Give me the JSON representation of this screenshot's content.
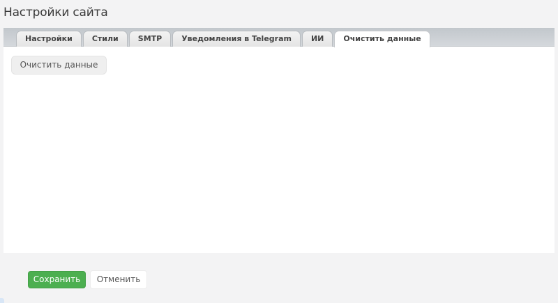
{
  "page": {
    "title": "Настройки сайта"
  },
  "tabs": [
    {
      "label": "Настройки",
      "active": false
    },
    {
      "label": "Стили",
      "active": false
    },
    {
      "label": "SMTP",
      "active": false
    },
    {
      "label": "Уведомления в Telegram",
      "active": false
    },
    {
      "label": "ИИ",
      "active": false
    },
    {
      "label": "Очистить данные",
      "active": true
    }
  ],
  "content": {
    "clear_button_label": "Очистить данные"
  },
  "footer": {
    "save_label": "Сохранить",
    "cancel_label": "Отменить"
  },
  "colors": {
    "save_button": "#4caf50",
    "tabbar": "#c8cdd2",
    "background": "#f3f3f4"
  }
}
